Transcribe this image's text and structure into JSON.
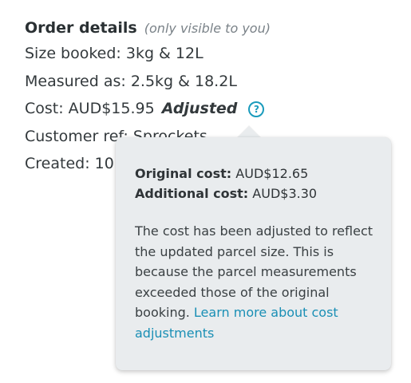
{
  "order_details": {
    "heading": "Order details",
    "visibility_note": "(only visible to you)",
    "size_booked": "Size booked: 3kg & 12L",
    "measured_as": "Measured as: 2.5kg & 18.2L",
    "cost_prefix": "Cost: AUD$15.95",
    "adjusted_label": "Adjusted",
    "help_icon_glyph": "?",
    "customer_ref": "Customer ref: Sprockets",
    "created": "Created: 10"
  },
  "tooltip": {
    "original_cost_label": "Original cost:",
    "original_cost_value": "AUD$12.65",
    "additional_cost_label": "Additional cost:",
    "additional_cost_value": "AUD$3.30",
    "explanation": "The cost has been adjusted to reflect the updated parcel size. This is because the parcel measurements exceeded those of the original booking.",
    "learn_more_link": "Learn more about cost adjustments"
  },
  "colors": {
    "text": "#2f3437",
    "muted": "#7a8288",
    "accent": "#1a9bbc",
    "link": "#1a8fb5",
    "tooltip_bg": "#e9ecee"
  },
  "icons": {
    "help": "question-circle-icon"
  }
}
